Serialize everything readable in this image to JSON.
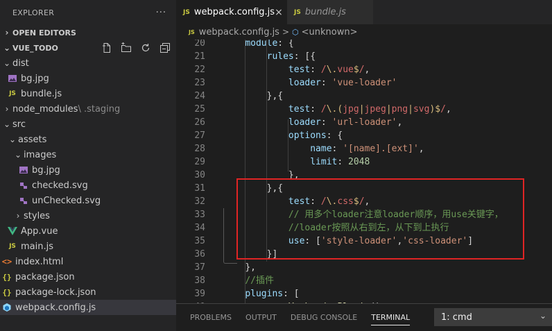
{
  "sidebar": {
    "title": "EXPLORER",
    "more": "···",
    "open_editors": "OPEN EDITORS",
    "project": "VUE_TODO",
    "tree": [
      {
        "label": "dist",
        "kind": "folder",
        "open": true,
        "depth": 0
      },
      {
        "label": "bg.jpg",
        "kind": "image",
        "depth": 1
      },
      {
        "label": "bundle.js",
        "kind": "js",
        "depth": 1
      },
      {
        "label": "node_modules",
        "suffix": " \\ .staging",
        "kind": "folder",
        "open": false,
        "depth": 0
      },
      {
        "label": "src",
        "kind": "folder",
        "open": true,
        "depth": 0
      },
      {
        "label": "assets",
        "kind": "folder",
        "open": true,
        "depth": 1
      },
      {
        "label": "images",
        "kind": "folder",
        "open": true,
        "depth": 2
      },
      {
        "label": "bg.jpg",
        "kind": "image",
        "depth": 3
      },
      {
        "label": "checked.svg",
        "kind": "svg",
        "depth": 3
      },
      {
        "label": "unChecked.svg",
        "kind": "svg",
        "depth": 3
      },
      {
        "label": "styles",
        "kind": "folder",
        "open": false,
        "depth": 2
      },
      {
        "label": "App.vue",
        "kind": "vue",
        "depth": 1
      },
      {
        "label": "main.js",
        "kind": "js",
        "depth": 1
      },
      {
        "label": "index.html",
        "kind": "html",
        "depth": 0
      },
      {
        "label": "package.json",
        "kind": "json",
        "depth": 0
      },
      {
        "label": "package-lock.json",
        "kind": "json",
        "depth": 0
      },
      {
        "label": "webpack.config.js",
        "kind": "webpack",
        "depth": 0,
        "selected": true
      }
    ]
  },
  "tabs": [
    {
      "label": "webpack.config.js",
      "active": true,
      "close": "×"
    },
    {
      "label": "bundle.js",
      "active": false
    }
  ],
  "breadcrumb": {
    "file": "webpack.config.js",
    "separator": ">",
    "symbol": "<unknown>"
  },
  "editor": {
    "lines": [
      {
        "n": "20",
        "tokens": [
          [
            "    ",
            "p"
          ],
          [
            "module",
            "k"
          ],
          [
            ": {",
            "p"
          ]
        ]
      },
      {
        "n": "21",
        "tokens": [
          [
            "        ",
            "p"
          ],
          [
            "rules",
            "k"
          ],
          [
            ": [{",
            "p"
          ]
        ]
      },
      {
        "n": "22",
        "tokens": [
          [
            "            ",
            "p"
          ],
          [
            "test",
            "k"
          ],
          [
            ": ",
            "p"
          ],
          [
            "/",
            "r"
          ],
          [
            "\\.",
            "d"
          ],
          [
            "vue",
            "r"
          ],
          [
            "$",
            "d"
          ],
          [
            "/",
            "r"
          ],
          [
            ",",
            "p"
          ]
        ]
      },
      {
        "n": "23",
        "tokens": [
          [
            "            ",
            "p"
          ],
          [
            "loader",
            "k"
          ],
          [
            ": ",
            "p"
          ],
          [
            "'vue-loader'",
            "s"
          ]
        ]
      },
      {
        "n": "24",
        "tokens": [
          [
            "        ",
            "p"
          ],
          [
            "},{",
            "p"
          ]
        ]
      },
      {
        "n": "25",
        "tokens": [
          [
            "            ",
            "p"
          ],
          [
            "test",
            "k"
          ],
          [
            ": ",
            "p"
          ],
          [
            "/",
            "r"
          ],
          [
            "\\.",
            "d"
          ],
          [
            "(",
            "d"
          ],
          [
            "jpg",
            "r"
          ],
          [
            "|",
            "d"
          ],
          [
            "jpeg",
            "r"
          ],
          [
            "|",
            "d"
          ],
          [
            "png",
            "r"
          ],
          [
            "|",
            "d"
          ],
          [
            "svg",
            "r"
          ],
          [
            ")",
            "d"
          ],
          [
            "$",
            "d"
          ],
          [
            "/",
            "r"
          ],
          [
            ",",
            "p"
          ]
        ]
      },
      {
        "n": "26",
        "tokens": [
          [
            "            ",
            "p"
          ],
          [
            "loader",
            "k"
          ],
          [
            ": ",
            "p"
          ],
          [
            "'url-loader'",
            "s"
          ],
          [
            ",",
            "p"
          ]
        ]
      },
      {
        "n": "27",
        "tokens": [
          [
            "            ",
            "p"
          ],
          [
            "options",
            "k"
          ],
          [
            ": {",
            "p"
          ]
        ]
      },
      {
        "n": "28",
        "tokens": [
          [
            "                ",
            "p"
          ],
          [
            "name",
            "k"
          ],
          [
            ": ",
            "p"
          ],
          [
            "'[name].[ext]'",
            "s"
          ],
          [
            ",",
            "p"
          ]
        ]
      },
      {
        "n": "29",
        "tokens": [
          [
            "                ",
            "p"
          ],
          [
            "limit",
            "k"
          ],
          [
            ": ",
            "p"
          ],
          [
            "2048",
            "n"
          ]
        ]
      },
      {
        "n": "30",
        "tokens": [
          [
            "            ",
            "p"
          ],
          [
            "},",
            "p"
          ]
        ]
      },
      {
        "n": "31",
        "tokens": [
          [
            "        ",
            "p"
          ],
          [
            "},{",
            "p"
          ]
        ]
      },
      {
        "n": "32",
        "tokens": [
          [
            "            ",
            "p"
          ],
          [
            "test",
            "k"
          ],
          [
            ": ",
            "p"
          ],
          [
            "/",
            "r"
          ],
          [
            "\\.",
            "d"
          ],
          [
            "css",
            "r"
          ],
          [
            "$",
            "d"
          ],
          [
            "/",
            "r"
          ],
          [
            ",",
            "p"
          ]
        ]
      },
      {
        "n": "33",
        "tokens": [
          [
            "            ",
            "p"
          ],
          [
            "// 用多个loader注意loader顺序，用use关键字，",
            "c"
          ]
        ]
      },
      {
        "n": "34",
        "tokens": [
          [
            "            ",
            "p"
          ],
          [
            "//loader按照从右到左，从下到上执行",
            "c"
          ]
        ]
      },
      {
        "n": "35",
        "tokens": [
          [
            "            ",
            "p"
          ],
          [
            "use",
            "k"
          ],
          [
            ": [",
            "p"
          ],
          [
            "'style-loader'",
            "s"
          ],
          [
            ",",
            "p"
          ],
          [
            "'css-loader'",
            "s"
          ],
          [
            "]",
            "p"
          ]
        ]
      },
      {
        "n": "36",
        "tokens": [
          [
            "        ",
            "p"
          ],
          [
            "}]",
            "p"
          ]
        ]
      },
      {
        "n": "37",
        "tokens": [
          [
            "    ",
            "p"
          ],
          [
            "},",
            "p"
          ]
        ]
      },
      {
        "n": "38",
        "tokens": [
          [
            "    ",
            "p"
          ],
          [
            "//插件",
            "c"
          ]
        ]
      },
      {
        "n": "39",
        "tokens": [
          [
            "    ",
            "p"
          ],
          [
            "plugins",
            "k"
          ],
          [
            ": [",
            "p"
          ]
        ]
      },
      {
        "n": "40",
        "tokens": [
          [
            "        ",
            "p"
          ],
          [
            "new ",
            "k"
          ],
          [
            "VueLoaderPlugin",
            "f"
          ],
          [
            "()",
            "p"
          ]
        ]
      }
    ]
  },
  "panel": {
    "tabs": [
      "PROBLEMS",
      "OUTPUT",
      "DEBUG CONSOLE",
      "TERMINAL"
    ],
    "active_tab": "TERMINAL",
    "terminal_select": "1: cmd"
  },
  "colors": {
    "highlight_box": "#e02424",
    "js_icon": "#cbcb41",
    "vue_icon": "#41b883"
  }
}
